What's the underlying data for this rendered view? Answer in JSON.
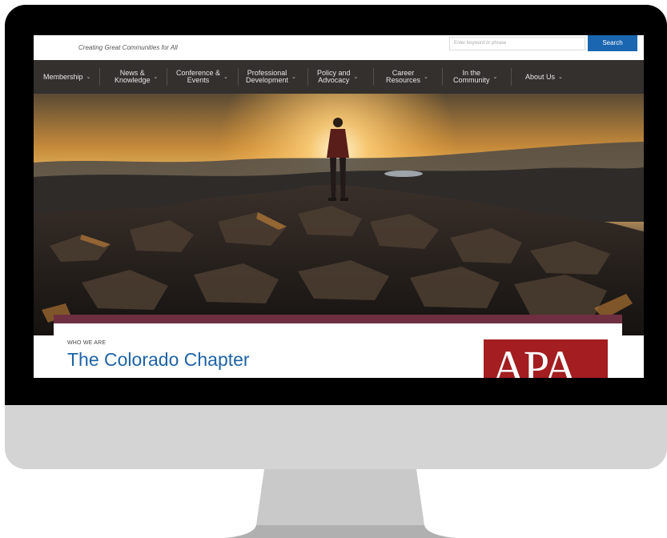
{
  "header": {
    "tagline": "Creating Great Communities for All",
    "search_placeholder": "Enter keyword or phrase",
    "search_button": "Search"
  },
  "nav": {
    "items": [
      {
        "label": "Membership"
      },
      {
        "label": "News &\nKnowledge"
      },
      {
        "label": "Conference &\nEvents"
      },
      {
        "label": "Professional\nDevelopment"
      },
      {
        "label": "Policy and\nAdvocacy"
      },
      {
        "label": "Career\nResources"
      },
      {
        "label": "In the\nCommunity"
      },
      {
        "label": "About Us"
      }
    ]
  },
  "intro": {
    "eyebrow": "WHO WE ARE",
    "title": "The Colorado Chapter",
    "logo_text": "APA"
  },
  "colors": {
    "nav_bg": "#33302e",
    "search_button": "#1b66b1",
    "card_band": "#6e2f41",
    "title": "#1e63a6",
    "logo_bg": "#a31d21"
  }
}
